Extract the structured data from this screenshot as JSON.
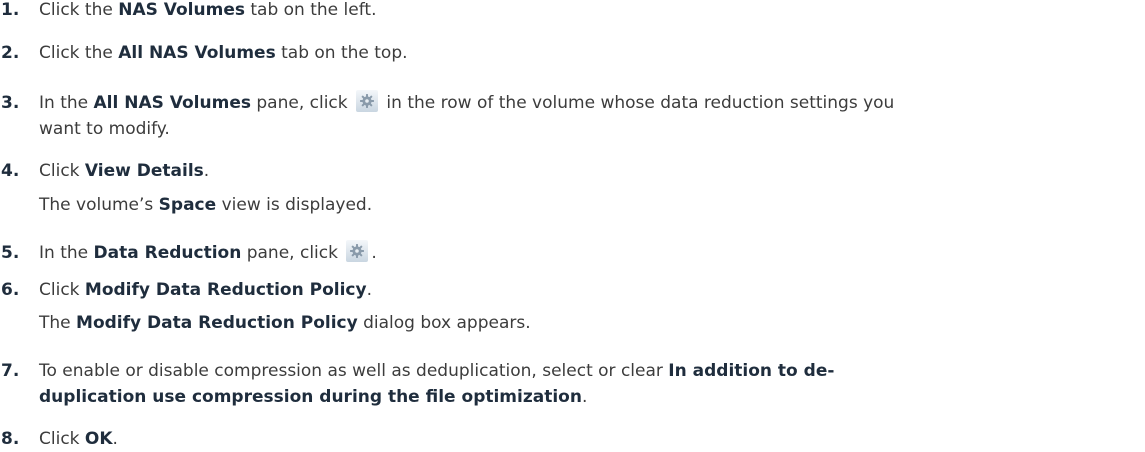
{
  "steps": [
    {
      "number": "1.",
      "pre": "Click the ",
      "b1": "NAS Volumes",
      "post": " tab on the left."
    },
    {
      "number": "2.",
      "pre": "Click the ",
      "b1": "All NAS Volumes",
      "post": " tab on the top."
    },
    {
      "number": "3.",
      "pre": "In the ",
      "b1": "All NAS Volumes",
      "mid": " pane, click ",
      "icon": "gear-icon",
      "post_line1": " in the row of the volume whose data reduction settings you",
      "post_line2": "want to modify."
    },
    {
      "number": "4.",
      "pre": "Click ",
      "b1": "View Details",
      "post": ".",
      "sub_pre": "The volume’s ",
      "sub_b": "Space",
      "sub_post": " view is displayed."
    },
    {
      "number": "5.",
      "pre": "In the ",
      "b1": "Data Reduction",
      "mid": " pane, click ",
      "icon": "gear-icon",
      "post": "."
    },
    {
      "number": "6.",
      "pre": "Click ",
      "b1": "Modify Data Reduction Policy",
      "post": ".",
      "sub_pre": "The ",
      "sub_b": "Modify Data Reduction Policy",
      "sub_post": " dialog box appears."
    },
    {
      "number": "7.",
      "pre": "To enable or disable compression as well as deduplication, select or clear ",
      "b1_line1": "In addition to de-",
      "b1_line2": "duplication use compression during the file optimization",
      "post": "."
    },
    {
      "number": "8.",
      "pre": "Click ",
      "b1": "OK",
      "post": "."
    }
  ],
  "colors": {
    "text": "#3c3c3c",
    "bold": "#1f2d3d",
    "gear": "#8a9bab"
  }
}
